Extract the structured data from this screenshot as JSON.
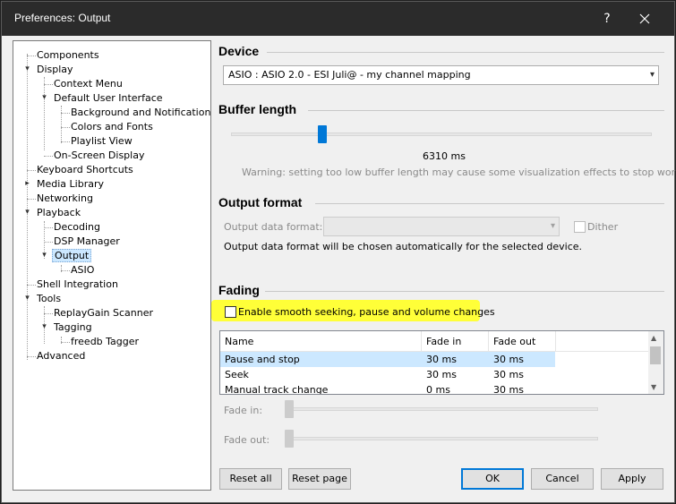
{
  "window": {
    "title": "Preferences: Output",
    "help_glyph": "?",
    "close_glyph": "✕"
  },
  "tree": {
    "items": [
      {
        "label": "Components"
      },
      {
        "label": "Display"
      },
      {
        "label": "Context Menu"
      },
      {
        "label": "Default User Interface"
      },
      {
        "label": "Background and Notifications"
      },
      {
        "label": "Colors and Fonts"
      },
      {
        "label": "Playlist View"
      },
      {
        "label": "On-Screen Display"
      },
      {
        "label": "Keyboard Shortcuts"
      },
      {
        "label": "Media Library"
      },
      {
        "label": "Networking"
      },
      {
        "label": "Playback"
      },
      {
        "label": "Decoding"
      },
      {
        "label": "DSP Manager"
      },
      {
        "label": "Output"
      },
      {
        "label": "ASIO"
      },
      {
        "label": "Shell Integration"
      },
      {
        "label": "Tools"
      },
      {
        "label": "ReplayGain Scanner"
      },
      {
        "label": "Tagging"
      },
      {
        "label": "freedb Tagger"
      },
      {
        "label": "Advanced"
      }
    ],
    "selected": "Output"
  },
  "device": {
    "title": "Device",
    "selected": "ASIO : ASIO 2.0 - ESI Juli@ - my channel mapping"
  },
  "buffer": {
    "title": "Buffer length",
    "value_text": "6310 ms",
    "value_fraction": 0.21,
    "warning": "Warning: setting too low buffer length may cause some visualization effects to stop working."
  },
  "output_format": {
    "title": "Output format",
    "label": "Output data format:",
    "selected": "",
    "dither_label": "Dither",
    "dither_checked": false,
    "note": "Output data format will be chosen automatically for the selected device."
  },
  "fading": {
    "title": "Fading",
    "enable_label": "Enable smooth seeking, pause and volume changes",
    "enable_checked": false,
    "highlight_color": "#ffff38",
    "columns": [
      "Name",
      "Fade in",
      "Fade out"
    ],
    "rows": [
      {
        "name": "Pause and stop",
        "fade_in": "30 ms",
        "fade_out": "30 ms"
      },
      {
        "name": "Seek",
        "fade_in": "30 ms",
        "fade_out": "30 ms"
      },
      {
        "name": "Manual track change",
        "fade_in": "0 ms",
        "fade_out": "30 ms"
      }
    ],
    "fade_in_label": "Fade in:",
    "fade_out_label": "Fade out:"
  },
  "buttons": {
    "reset_all": "Reset all",
    "reset_page": "Reset page",
    "ok": "OK",
    "cancel": "Cancel",
    "apply": "Apply"
  },
  "colors": {
    "accent": "#0078d7",
    "selection": "#cce8ff",
    "titlebar": "#2b2b2b"
  }
}
